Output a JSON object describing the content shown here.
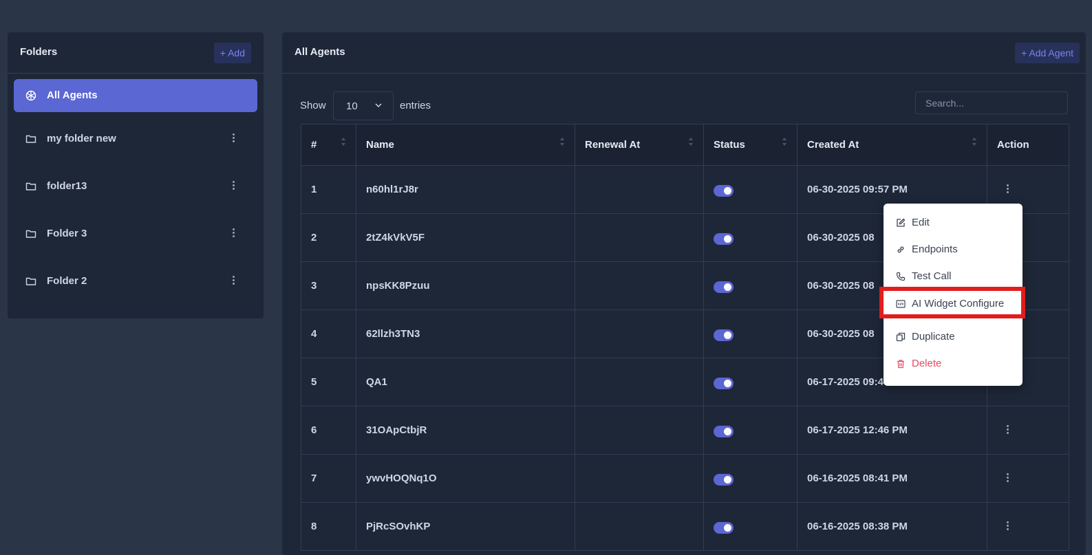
{
  "folders_panel": {
    "title": "Folders",
    "add_label": "+ Add",
    "items": [
      {
        "label": "All Agents",
        "icon": "agents-icon",
        "active": true
      },
      {
        "label": "my folder new",
        "icon": "folder-icon"
      },
      {
        "label": "folder13",
        "icon": "folder-icon"
      },
      {
        "label": "Folder 3",
        "icon": "folder-icon"
      },
      {
        "label": "Folder 2",
        "icon": "folder-icon"
      }
    ]
  },
  "agents_panel": {
    "title": "All Agents",
    "add_label": "+ Add Agent",
    "show_label": "Show",
    "entries_value": "10",
    "entries_label": "entries",
    "search_placeholder": "Search...",
    "columns": [
      "#",
      "Name",
      "Renewal At",
      "Status",
      "Created At",
      "Action"
    ],
    "rows": [
      {
        "num": "1",
        "name": "n60hl1rJ8r",
        "renewal": "",
        "status": true,
        "created": "06-30-2025 09:57 PM"
      },
      {
        "num": "2",
        "name": "2tZ4kVkV5F",
        "renewal": "",
        "status": true,
        "created": "06-30-2025 08"
      },
      {
        "num": "3",
        "name": "npsKK8Pzuu",
        "renewal": "",
        "status": true,
        "created": "06-30-2025 08"
      },
      {
        "num": "4",
        "name": "62llzh3TN3",
        "renewal": "",
        "status": true,
        "created": "06-30-2025 08"
      },
      {
        "num": "5",
        "name": "QA1",
        "renewal": "",
        "status": true,
        "created": "06-17-2025 09:45 PM"
      },
      {
        "num": "6",
        "name": "31OApCtbjR",
        "renewal": "",
        "status": true,
        "created": "06-17-2025 12:46 PM"
      },
      {
        "num": "7",
        "name": "ywvHOQNq1O",
        "renewal": "",
        "status": true,
        "created": "06-16-2025 08:41 PM"
      },
      {
        "num": "8",
        "name": "PjRcSOvhKP",
        "renewal": "",
        "status": true,
        "created": "06-16-2025 08:38 PM"
      }
    ]
  },
  "action_menu": {
    "items": [
      {
        "label": "Edit",
        "icon": "edit-icon"
      },
      {
        "label": "Endpoints",
        "icon": "link-icon"
      },
      {
        "label": "Test Call",
        "icon": "phone-icon"
      },
      {
        "label": "AI Widget Configure",
        "icon": "code-icon",
        "highlighted": true
      },
      {
        "label": "Duplicate",
        "icon": "copy-icon"
      },
      {
        "label": "Delete",
        "icon": "trash-icon",
        "danger": true
      }
    ]
  },
  "colors": {
    "page_bg": "#2a3548",
    "panel_bg": "#1e2738",
    "accent": "#5b67d2",
    "danger": "#e44b63",
    "highlight": "#e11d1d"
  }
}
